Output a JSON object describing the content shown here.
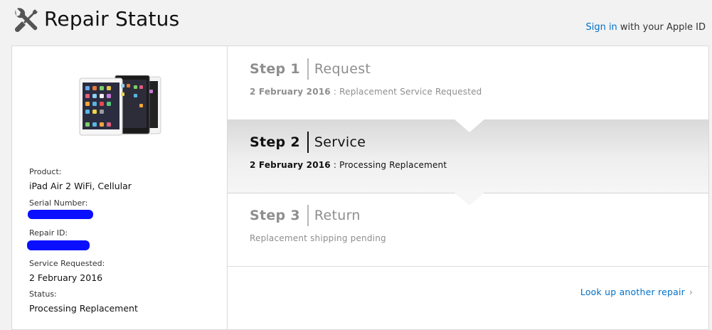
{
  "header": {
    "title": "Repair Status",
    "signin_link": "Sign in",
    "signin_suffix": " with your Apple ID",
    "icon": "tools-icon"
  },
  "device": {
    "image": "ipad-air-2-image",
    "fields": [
      {
        "label": "Product:",
        "value": "iPad Air 2 WiFi, Cellular"
      },
      {
        "label": "Serial Number:",
        "value": ""
      },
      {
        "label": "Repair ID:",
        "value": ""
      },
      {
        "label": "Service Requested:",
        "value": "2 February 2016"
      },
      {
        "label": "Status:",
        "value": "Processing Replacement"
      }
    ]
  },
  "steps": [
    {
      "number": "Step 1",
      "name": "Request",
      "date": "2 February 2016",
      "separator": " : ",
      "description": "Replacement Service Requested"
    },
    {
      "number": "Step 2",
      "name": "Service",
      "date": "2 February 2016",
      "separator": " : ",
      "description": "Processing Replacement"
    },
    {
      "number": "Step 3",
      "name": "Return",
      "date": "",
      "separator": "",
      "description": "Replacement shipping pending"
    }
  ],
  "lookup_link": "Look up another repair",
  "colors": {
    "link": "#0070c9",
    "redaction": "#0a10ff",
    "muted": "#8e8e8e"
  }
}
